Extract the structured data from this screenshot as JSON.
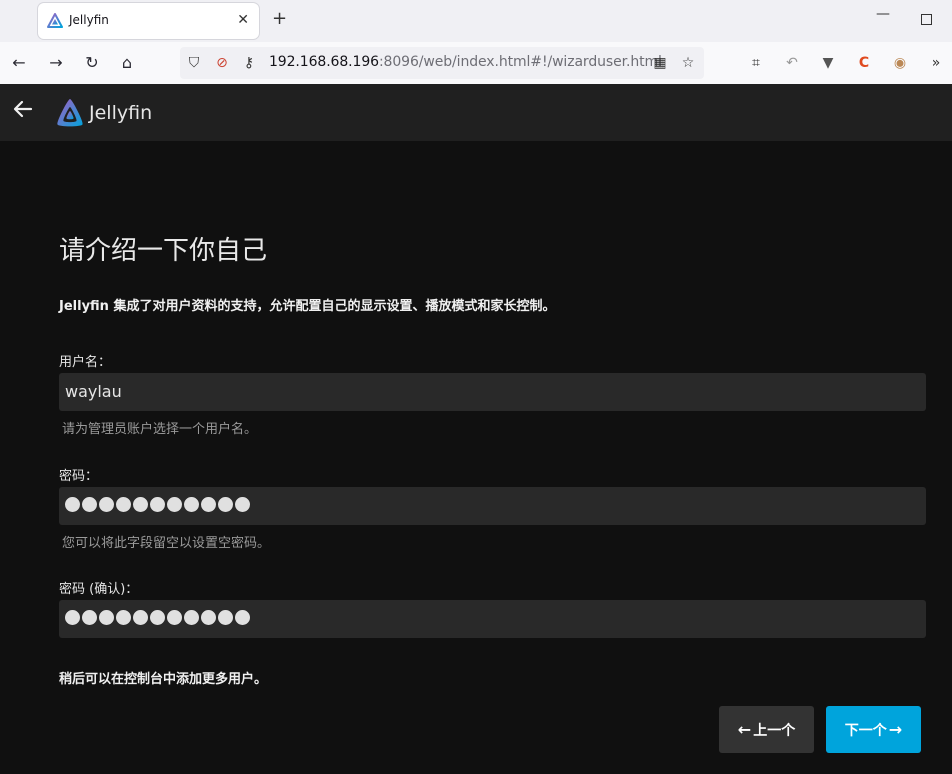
{
  "browser": {
    "tab_title": "Jellyfin",
    "url_main": "192.168.68.196",
    "url_rest": ":8096/web/index.html#!/wizarduser.html"
  },
  "app": {
    "name": "Jellyfin",
    "accent_color": "#00a4dc"
  },
  "page": {
    "title": "请介绍一下你自己",
    "intro": "Jellyfin 集成了对用户资料的支持，允许配置自己的显示设置、播放模式和家长控制。"
  },
  "form": {
    "username": {
      "label": "用户名：",
      "value": "waylau",
      "help": "请为管理员账户选择一个用户名。"
    },
    "password": {
      "label": "密码：",
      "dot_count": 11,
      "help": "您可以将此字段留空以设置空密码。"
    },
    "password_confirm": {
      "label": "密码 (确认)：",
      "dot_count": 11
    },
    "footer_note": "稍后可以在控制台中添加更多用户。"
  },
  "buttons": {
    "prev_label": "上一个",
    "next_label": "下一个"
  }
}
